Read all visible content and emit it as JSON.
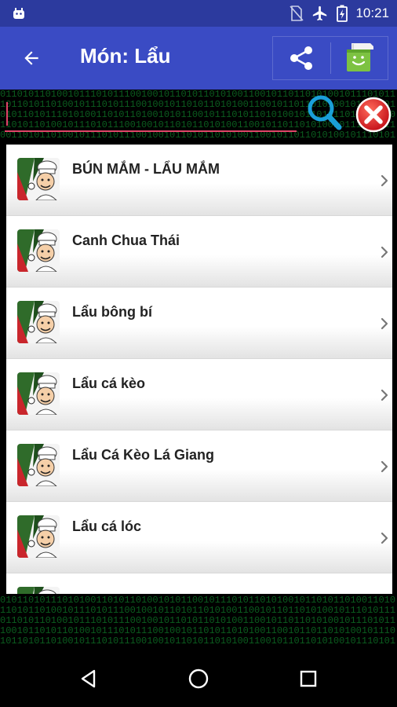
{
  "status_bar": {
    "time": "10:21",
    "icons": [
      "android-icon",
      "no-sim-icon",
      "airplane-icon",
      "battery-charging-icon"
    ]
  },
  "app_bar": {
    "title": "Món: Lẩu",
    "back_icon": "arrow-back-icon",
    "actions": [
      "share-icon",
      "store-icon"
    ]
  },
  "search": {
    "value": "",
    "placeholder": "",
    "search_icon": "search-icon",
    "clear_icon": "clear-icon"
  },
  "matrix_text": {
    "lines": [
      "0110101101001011101011100100101101011010100110010110110101001011101011",
      "1011010110100101110101110010010110101101010011001011011010100101110101",
      "0101101011101010011010110100101011001011101011010100101101011010011010",
      "1101011010010111010111001001011010110101001100101101101010010111010111",
      "0011010110100101110101110010010110101101010011001011011010100101110101",
      "1001011010110100101110101110010010110101101010011001011011010100101110"
    ]
  },
  "recipes": [
    {
      "label": "BÚN MẮM - LẨU MẮM"
    },
    {
      "label": "Canh Chua Thái"
    },
    {
      "label": "Lẩu bông bí"
    },
    {
      "label": "Lẩu cá kèo"
    },
    {
      "label": "Lẩu Cá Kèo Lá Giang"
    },
    {
      "label": "Lẩu cá lóc"
    },
    {
      "label": ""
    }
  ],
  "nav_bar": {
    "buttons": [
      "back-triangle-icon",
      "home-circle-icon",
      "recents-square-icon"
    ]
  },
  "colors": {
    "status_bar": "#2c3a9e",
    "app_bar": "#3a4bc4",
    "input_underline": "#e04468",
    "matrix_green": "#0b5e1f",
    "search_blue": "#1a9fd8",
    "clear_red": "#e0262b"
  }
}
